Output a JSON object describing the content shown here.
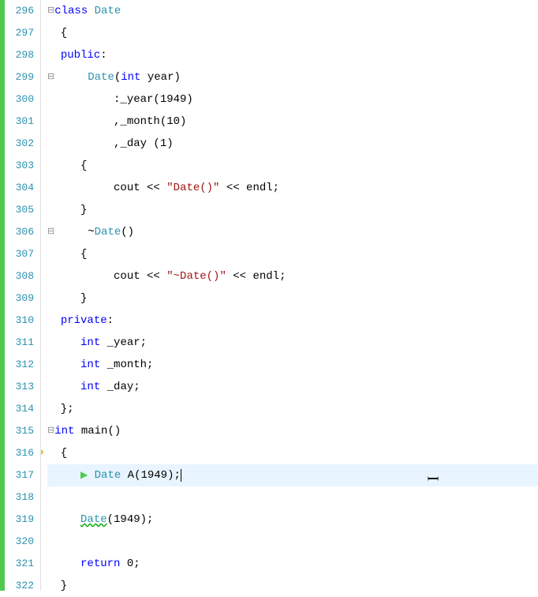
{
  "title": "class Date",
  "lines": [
    {
      "num": "296",
      "tokens": [
        {
          "t": "collapse",
          "v": "⊟"
        },
        {
          "t": "kw",
          "v": "class"
        },
        {
          "t": "plain",
          "v": " "
        },
        {
          "t": "type",
          "v": "Date"
        }
      ]
    },
    {
      "num": "297",
      "tokens": [
        {
          "t": "plain",
          "v": "  {"
        }
      ]
    },
    {
      "num": "298",
      "tokens": [
        {
          "t": "plain",
          "v": "  "
        },
        {
          "t": "kw",
          "v": "public"
        },
        {
          "t": "plain",
          "v": ":"
        }
      ]
    },
    {
      "num": "299",
      "tokens": [
        {
          "t": "collapse",
          "v": "⊟"
        },
        {
          "t": "plain",
          "v": "     "
        },
        {
          "t": "type",
          "v": "Date"
        },
        {
          "t": "plain",
          "v": "("
        },
        {
          "t": "kw",
          "v": "int"
        },
        {
          "t": "plain",
          "v": " year)"
        }
      ]
    },
    {
      "num": "300",
      "tokens": [
        {
          "t": "plain",
          "v": "          :_year(1949)"
        }
      ]
    },
    {
      "num": "301",
      "tokens": [
        {
          "t": "plain",
          "v": "          ,_month(10)"
        }
      ]
    },
    {
      "num": "302",
      "tokens": [
        {
          "t": "plain",
          "v": "          ,_day (1)"
        }
      ]
    },
    {
      "num": "303",
      "tokens": [
        {
          "t": "plain",
          "v": "     {"
        }
      ]
    },
    {
      "num": "304",
      "tokens": [
        {
          "t": "plain",
          "v": "          cout << "
        },
        {
          "t": "str",
          "v": "\"Date()\""
        },
        {
          "t": "plain",
          "v": " << endl;"
        }
      ]
    },
    {
      "num": "305",
      "tokens": [
        {
          "t": "plain",
          "v": "     }"
        }
      ]
    },
    {
      "num": "306",
      "tokens": [
        {
          "t": "collapse",
          "v": "⊟"
        },
        {
          "t": "plain",
          "v": "     "
        },
        {
          "t": "tilde",
          "v": "~"
        },
        {
          "t": "type",
          "v": "Date"
        },
        {
          "t": "plain",
          "v": "()"
        }
      ]
    },
    {
      "num": "307",
      "tokens": [
        {
          "t": "plain",
          "v": "     {"
        }
      ]
    },
    {
      "num": "308",
      "tokens": [
        {
          "t": "plain",
          "v": "          cout << "
        },
        {
          "t": "str",
          "v": "\"~Date()\""
        },
        {
          "t": "plain",
          "v": " << endl;"
        }
      ]
    },
    {
      "num": "309",
      "tokens": [
        {
          "t": "plain",
          "v": "     }"
        }
      ]
    },
    {
      "num": "310",
      "tokens": [
        {
          "t": "plain",
          "v": "  "
        },
        {
          "t": "kw",
          "v": "private"
        },
        {
          "t": "plain",
          "v": ":"
        }
      ]
    },
    {
      "num": "311",
      "tokens": [
        {
          "t": "plain",
          "v": "     "
        },
        {
          "t": "kw",
          "v": "int"
        },
        {
          "t": "plain",
          "v": " _year;"
        }
      ]
    },
    {
      "num": "312",
      "tokens": [
        {
          "t": "plain",
          "v": "     "
        },
        {
          "t": "kw",
          "v": "int"
        },
        {
          "t": "plain",
          "v": " _month;"
        }
      ]
    },
    {
      "num": "313",
      "tokens": [
        {
          "t": "plain",
          "v": "     "
        },
        {
          "t": "kw",
          "v": "int"
        },
        {
          "t": "plain",
          "v": " _day;"
        }
      ]
    },
    {
      "num": "314",
      "tokens": [
        {
          "t": "plain",
          "v": "  };"
        }
      ]
    },
    {
      "num": "315",
      "tokens": [
        {
          "t": "collapse",
          "v": "⊟"
        },
        {
          "t": "kw",
          "v": "int"
        },
        {
          "t": "plain",
          "v": " main()"
        }
      ]
    },
    {
      "num": "316",
      "tokens": [
        {
          "t": "plain",
          "v": "  {"
        }
      ],
      "arrow": true
    },
    {
      "num": "317",
      "tokens": [
        {
          "t": "plain",
          "v": "     "
        },
        {
          "t": "green_arrow",
          "v": "▶"
        },
        {
          "t": "plain",
          "v": " "
        },
        {
          "t": "type",
          "v": "Date"
        },
        {
          "t": "plain",
          "v": " A(1949);"
        },
        {
          "t": "cursor",
          "v": ""
        }
      ],
      "cursor": true,
      "highlight": true
    },
    {
      "num": "318",
      "tokens": []
    },
    {
      "num": "319",
      "tokens": [
        {
          "t": "plain",
          "v": "     "
        },
        {
          "t": "type_squiggle",
          "v": "Date"
        },
        {
          "t": "plain",
          "v": "(1949);"
        }
      ]
    },
    {
      "num": "320",
      "tokens": []
    },
    {
      "num": "321",
      "tokens": [
        {
          "t": "plain",
          "v": "     "
        },
        {
          "t": "kw",
          "v": "return"
        },
        {
          "t": "plain",
          "v": " 0;"
        }
      ]
    },
    {
      "num": "322",
      "tokens": [
        {
          "t": "plain",
          "v": "  }"
        }
      ]
    }
  ]
}
